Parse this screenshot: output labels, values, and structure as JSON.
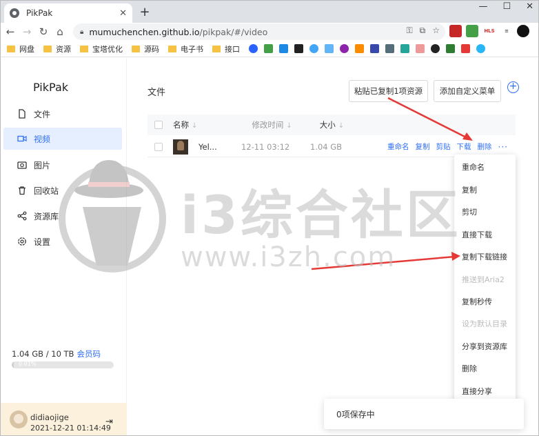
{
  "browser": {
    "tab_title": "PikPak",
    "tab_close": "✕",
    "new_tab": "+",
    "window_controls": [
      "—",
      "☐",
      "✕"
    ],
    "url_host": "mumuchenchen.github.io",
    "url_path": "/pikpak/#/video",
    "bookmarks": [
      "网盘",
      "资源",
      "宝塔优化",
      "源码",
      "电子书",
      "接口"
    ]
  },
  "app": {
    "brand": "PikPak",
    "nav": [
      {
        "label": "文件",
        "icon": "file-icon"
      },
      {
        "label": "视频",
        "icon": "video-icon"
      },
      {
        "label": "图片",
        "icon": "image-icon"
      },
      {
        "label": "回收站",
        "icon": "trash-icon"
      },
      {
        "label": "资源库",
        "icon": "share-icon"
      },
      {
        "label": "设置",
        "icon": "settings-icon"
      }
    ],
    "active_nav": "视频",
    "storage_text": "1.04 GB / 10 TB",
    "vip_link": "会员码",
    "storage_pct_label": "0.01%",
    "storage_fraction": 0.0001,
    "user_name": "didiaojige",
    "user_time": "2021-12-21 01:14:49"
  },
  "main": {
    "heading": "文件",
    "paste_button": "粘贴已复制1项资源",
    "custom_menu_button": "添加自定义菜单",
    "add_button": "+",
    "columns": {
      "name": "名称",
      "modified": "修改时间",
      "size": "大小"
    },
    "file": {
      "name": "Yel...",
      "modified": "12-11 03:12",
      "size": "1.04 GB",
      "actions": [
        "重命名",
        "复制",
        "剪贴",
        "下载",
        "删除"
      ],
      "more": "···"
    }
  },
  "context_menu": {
    "items": [
      {
        "label": "重命名",
        "enabled": true
      },
      {
        "label": "复制",
        "enabled": true
      },
      {
        "label": "剪切",
        "enabled": true
      },
      {
        "label": "直接下载",
        "enabled": true
      },
      {
        "label": "复制下载链接",
        "enabled": true
      },
      {
        "label": "推送到Aria2",
        "enabled": false
      },
      {
        "label": "复制秒传",
        "enabled": true
      },
      {
        "label": "设为默认目录",
        "enabled": false
      },
      {
        "label": "分享到资源库",
        "enabled": true
      },
      {
        "label": "删除",
        "enabled": true
      },
      {
        "label": "直接分享",
        "enabled": true
      }
    ]
  },
  "toast": "0项保存中",
  "watermark": {
    "line1": "i3综合社区",
    "line2": "www.i3zh.com"
  },
  "colors": {
    "accent": "#306ff5",
    "active_bg": "#e6efff",
    "arrow": "#e53935",
    "user_bg": "#fbf1dc"
  }
}
